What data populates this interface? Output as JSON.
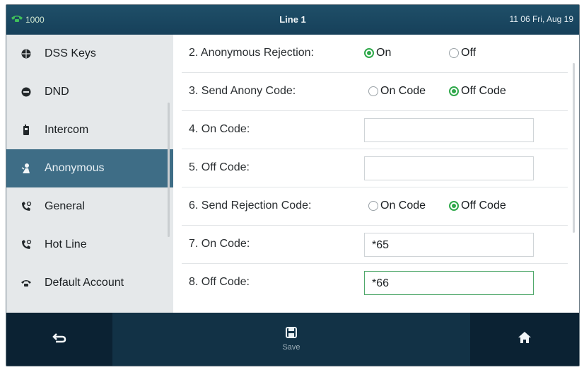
{
  "status_bar": {
    "account": "1000",
    "title": "Line 1",
    "datetime": "11 06 Fri, Aug 19"
  },
  "sidebar": {
    "items": [
      {
        "label": "DSS Keys",
        "icon": "globe-icon"
      },
      {
        "label": "DND",
        "icon": "dnd-icon"
      },
      {
        "label": "Intercom",
        "icon": "intercom-icon"
      },
      {
        "label": "Anonymous",
        "icon": "anonymous-icon",
        "active": true
      },
      {
        "label": "General",
        "icon": "phone-settings-icon"
      },
      {
        "label": "Hot Line",
        "icon": "phone-settings-icon"
      },
      {
        "label": "Default Account",
        "icon": "phone-icon"
      }
    ]
  },
  "settings": {
    "anonymous_rejection": {
      "label": "2. Anonymous Rejection:",
      "options": [
        "On",
        "Off"
      ],
      "selected": "On"
    },
    "send_anony_code": {
      "label": "3. Send Anony Code:",
      "options": [
        "On Code",
        "Off Code"
      ],
      "selected": "Off Code"
    },
    "anony_on_code": {
      "label": "4. On Code:",
      "value": ""
    },
    "anony_off_code": {
      "label": "5. Off Code:",
      "value": ""
    },
    "send_rejection_code": {
      "label": "6. Send Rejection Code:",
      "options": [
        "On Code",
        "Off Code"
      ],
      "selected": "Off Code"
    },
    "rejection_on_code": {
      "label": "7. On Code:",
      "value": "*65"
    },
    "rejection_off_code": {
      "label": "8. Off Code:",
      "value": "*66"
    }
  },
  "softkeys": {
    "back": {
      "label": "",
      "icon": "back-arrow-icon"
    },
    "save": {
      "label": "Save",
      "icon": "save-icon"
    },
    "home": {
      "label": "",
      "icon": "home-icon"
    }
  },
  "colors": {
    "accent_green": "#2fa84a",
    "active_item": "#3e6d86",
    "status_bar": "#1a4660",
    "softkey_bar": "#0b2233"
  }
}
